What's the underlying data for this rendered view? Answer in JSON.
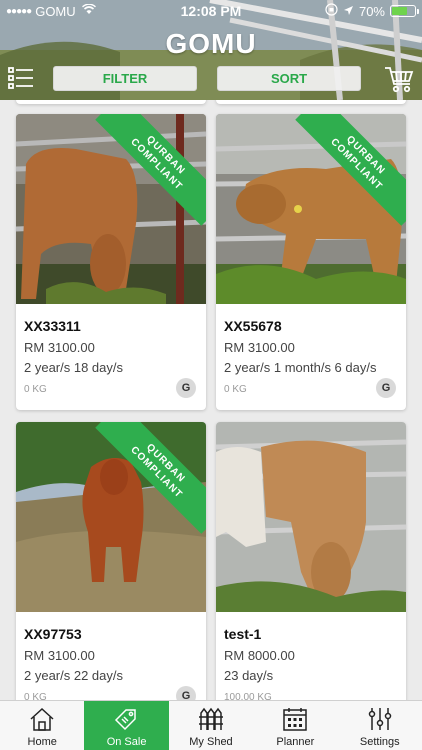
{
  "status_bar": {
    "carrier": "GOMU",
    "time": "12:08 PM",
    "battery": "70%",
    "battery_level": 0.7
  },
  "header": {
    "logo": "GOMU",
    "filter_label": "FILTER",
    "sort_label": "SORT",
    "icons": {
      "menu": "list-menu-icon",
      "cart": "shopping-cart-icon"
    }
  },
  "listings": [
    {
      "code": "XX33311",
      "price": "RM 3100.00",
      "age": "2 year/s  18 day/s",
      "weight": "0 KG",
      "badge": "G",
      "qurban": true,
      "ribbon": [
        "QURBAN",
        "COMPLIANT"
      ]
    },
    {
      "code": "XX55678",
      "price": "RM 3100.00",
      "age": "2 year/s  1 month/s  6 day/s",
      "weight": "0 KG",
      "badge": "G",
      "qurban": true,
      "ribbon": [
        "QURBAN",
        "COMPLIANT"
      ]
    },
    {
      "code": "XX97753",
      "price": "RM 3100.00",
      "age": "2 year/s  22 day/s",
      "weight": "0 KG",
      "badge": "G",
      "qurban": true,
      "ribbon": [
        "QURBAN",
        "COMPLIANT"
      ]
    },
    {
      "code": "test-1",
      "price": "RM 8000.00",
      "age": "23 day/s",
      "weight": "100.00 KG",
      "badge": "",
      "qurban": false
    }
  ],
  "tabs": [
    {
      "label": "Home",
      "icon": "home-icon",
      "active": false
    },
    {
      "label": "On Sale",
      "icon": "price-tag-icon",
      "active": true
    },
    {
      "label": "My Shed",
      "icon": "shed-fence-icon",
      "active": false
    },
    {
      "label": "Planner",
      "icon": "calendar-icon",
      "active": false
    },
    {
      "label": "Settings",
      "icon": "sliders-icon",
      "active": false
    }
  ],
  "colors": {
    "accent": "#2fae4e",
    "ribbon": "#2fae4e",
    "card": "#ffffff",
    "background": "#ebebeb"
  }
}
